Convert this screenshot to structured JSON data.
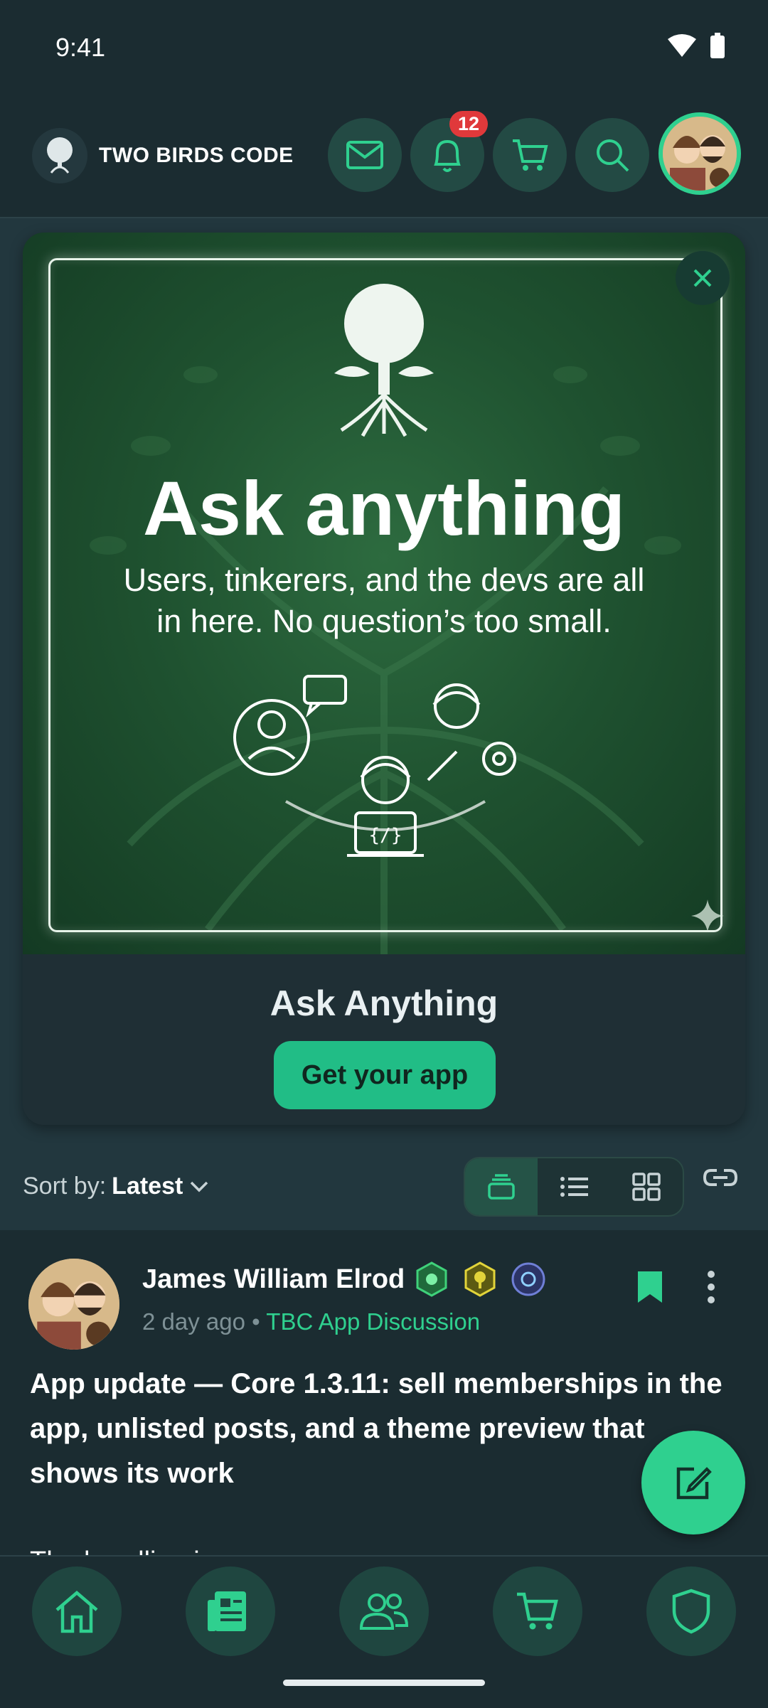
{
  "status": {
    "time": "9:41"
  },
  "header": {
    "brand": "TWO BIRDS CODE",
    "notification_count": "12",
    "icons": [
      "mail-icon",
      "bell-icon",
      "cart-icon",
      "search-icon"
    ]
  },
  "promo": {
    "hero_title": "Ask anything",
    "hero_subtitle": "Users, tinkerers, and the devs are all in here. No question’s too small.",
    "code_glyph": "{/}",
    "title": "Ask Anything",
    "cta_label": "Get your app"
  },
  "sort": {
    "label": "Sort by:",
    "value": "Latest"
  },
  "post": {
    "author": "James William Elrod",
    "time": "2 day ago",
    "separator": "•",
    "category": "TBC App Discussion",
    "title": "App update — Core 1.3.11: sell memberships in the app, unlisted posts, and a theme preview that shows its work",
    "excerpt_fragment": "The headline is ..."
  },
  "colors": {
    "accent": "#2fd08f",
    "cta": "#21bd86",
    "badge": "#e0393b",
    "background": "#1b2c31"
  },
  "bottom_nav": [
    "home-icon",
    "news-icon",
    "people-icon",
    "cart-icon",
    "shield-icon"
  ]
}
